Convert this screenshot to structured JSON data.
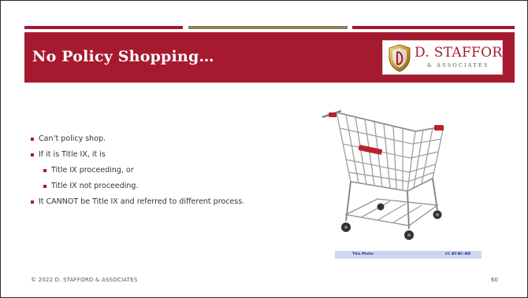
{
  "slide": {
    "title": "No Policy Shopping…",
    "colors": {
      "accent": "#a61a30",
      "gold_bar": "#8c7f57"
    }
  },
  "logo": {
    "name": "D. STAFFORD",
    "sub": "& ASSOCIATES",
    "icon": "shield-icon"
  },
  "bullets": [
    {
      "level": 1,
      "text": "Can’t policy shop."
    },
    {
      "level": 1,
      "text": "If it is Title IX, it is"
    },
    {
      "level": 2,
      "text": "Title IX proceeding, or"
    },
    {
      "level": 2,
      "text": "Title IX not proceeding."
    },
    {
      "level": 1,
      "text": "It CANNOT be Title IX and referred to different process."
    }
  ],
  "image": {
    "icon": "shopping-cart-icon",
    "credit": {
      "link": "This Photo",
      "middle": "by Unknown Author is licensed under",
      "license": "CC BY-NC-ND"
    }
  },
  "footer": {
    "copyright": "© 2022 D. STAFFORD & ASSOCIATES",
    "page_number": "60"
  }
}
